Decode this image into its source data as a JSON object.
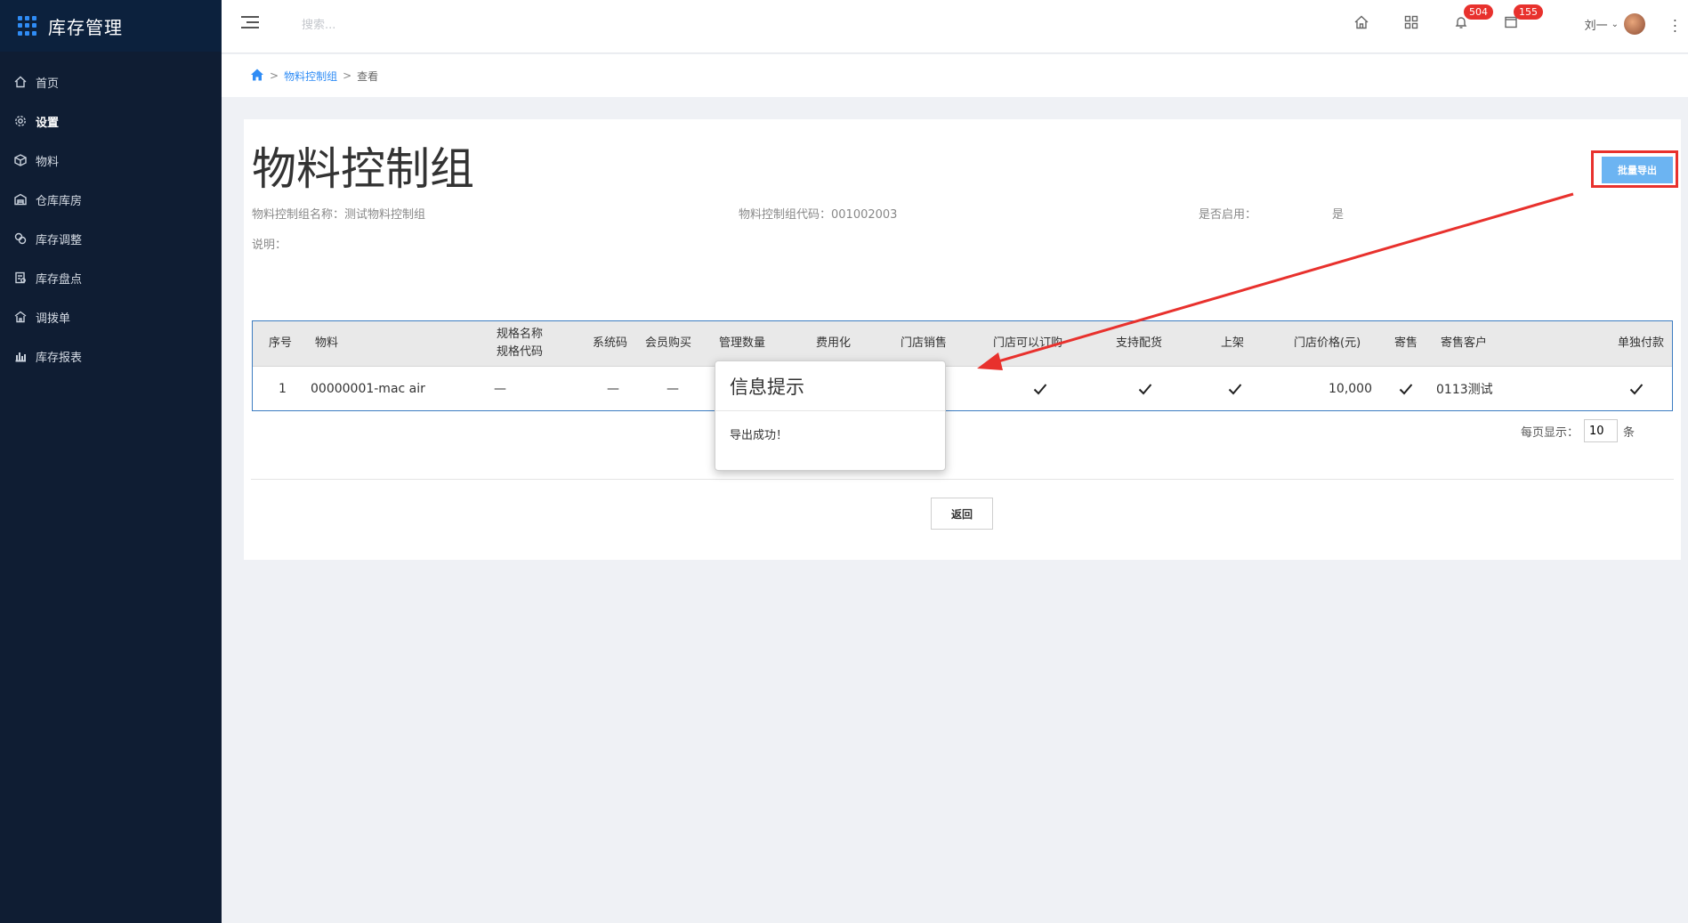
{
  "app": {
    "title": "库存管理"
  },
  "sidebar": {
    "items": [
      {
        "label": "首页",
        "icon": "home-icon",
        "active": false
      },
      {
        "label": "设置",
        "icon": "gear-icon",
        "active": true
      },
      {
        "label": "物料",
        "icon": "cube-icon",
        "active": false
      },
      {
        "label": "仓库库房",
        "icon": "warehouse-icon",
        "active": false
      },
      {
        "label": "库存调整",
        "icon": "adjust-icon",
        "active": false
      },
      {
        "label": "库存盘点",
        "icon": "inventory-check-icon",
        "active": false
      },
      {
        "label": "调拨单",
        "icon": "transfer-icon",
        "active": false
      },
      {
        "label": "库存报表",
        "icon": "bar-chart-icon",
        "active": false
      }
    ]
  },
  "header": {
    "search_placeholder": "搜索...",
    "badges": {
      "notifications": "504",
      "messages": "155"
    },
    "user": "刘一"
  },
  "breadcrumb": {
    "link": "物料控制组",
    "current": "查看"
  },
  "page": {
    "title": "物料控制组",
    "export_button": "批量导出",
    "name_label": "物料控制组名称：",
    "name_value": "测试物料控制组",
    "code_label": "物料控制组代码：",
    "code_value": "001002003",
    "enabled_label": "是否启用：",
    "enabled_value": "是",
    "desc_label": "说明："
  },
  "table": {
    "headers": {
      "seq": "序号",
      "material": "物料",
      "spec_name": "规格名称",
      "spec_code": "规格代码",
      "syscode": "系统码",
      "member_buy": "会员购买",
      "manage_qty": "管理数量",
      "expense": "费用化",
      "store_sale": "门店销售",
      "store_order": "门店可以订购",
      "delivery": "支持配货",
      "shelf": "上架",
      "price": "门店价格(元)",
      "consign": "寄售",
      "consign_customer": "寄售客户",
      "separate_pay": "单独付款"
    },
    "rows": [
      {
        "seq": "1",
        "material": "00000001-mac air",
        "spec": "—",
        "syscode": "—",
        "member_buy": "—",
        "price": "10,000",
        "consign_customer": "0113测试"
      }
    ]
  },
  "pager": {
    "label": "每页显示：",
    "value": "10",
    "unit": "条"
  },
  "back_button": "返回",
  "modal": {
    "title": "信息提示",
    "message": "导出成功！"
  },
  "colors": {
    "sidebar_bg": "#0f1d33",
    "accent": "#2f8cf5",
    "annotation_red": "#e8312d"
  }
}
